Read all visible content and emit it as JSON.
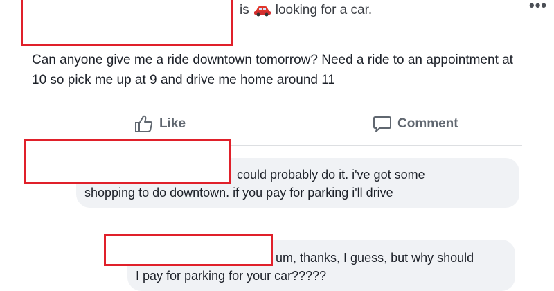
{
  "post": {
    "status_text": "is",
    "status_icon": "car-icon",
    "status_suffix": "looking for a car.",
    "more_label": "•••",
    "body": "Can anyone give me a ride downtown tomorrow? Need a ride to an appointment at 10 so pick me up at 9 and drive me home around 11"
  },
  "actions": {
    "like_label": "Like",
    "comment_label": "Comment"
  },
  "comments": [
    {
      "line1": "could probably do it. i've got some",
      "line2": "shopping to do downtown. if you pay for parking i'll drive"
    },
    {
      "line1": "um, thanks, I guess, but why should",
      "line2": "I pay for parking for your car?????"
    }
  ],
  "colors": {
    "redaction_border": "#e0202a",
    "bubble_bg": "#f0f2f5",
    "action_text": "#606770"
  }
}
